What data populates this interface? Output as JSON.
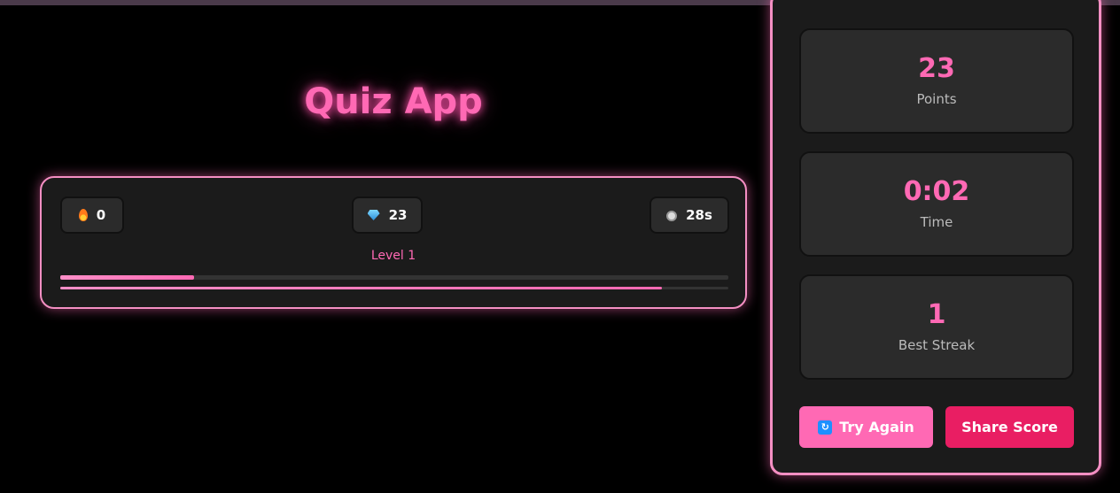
{
  "app": {
    "title": "Quiz App"
  },
  "status": {
    "streak": {
      "icon": "flame-icon",
      "value": "0"
    },
    "gems": {
      "icon": "gem-icon",
      "value": "23"
    },
    "timer": {
      "icon": "stopwatch-icon",
      "value": "28s"
    },
    "level_label": "Level 1",
    "level_progress": 0.2,
    "time_progress": 0.9
  },
  "results": {
    "points": {
      "value": "23",
      "label": "Points"
    },
    "time": {
      "value": "0:02",
      "label": "Time"
    },
    "best_streak": {
      "value": "1",
      "label": "Best Streak"
    }
  },
  "actions": {
    "try_again_label": "Try Again",
    "try_again_icon": "retry-icon",
    "share_label": "Share Score"
  },
  "colors": {
    "accent": "#ff69b4",
    "accent_dark": "#e91e63",
    "border": "#f48fc3"
  }
}
